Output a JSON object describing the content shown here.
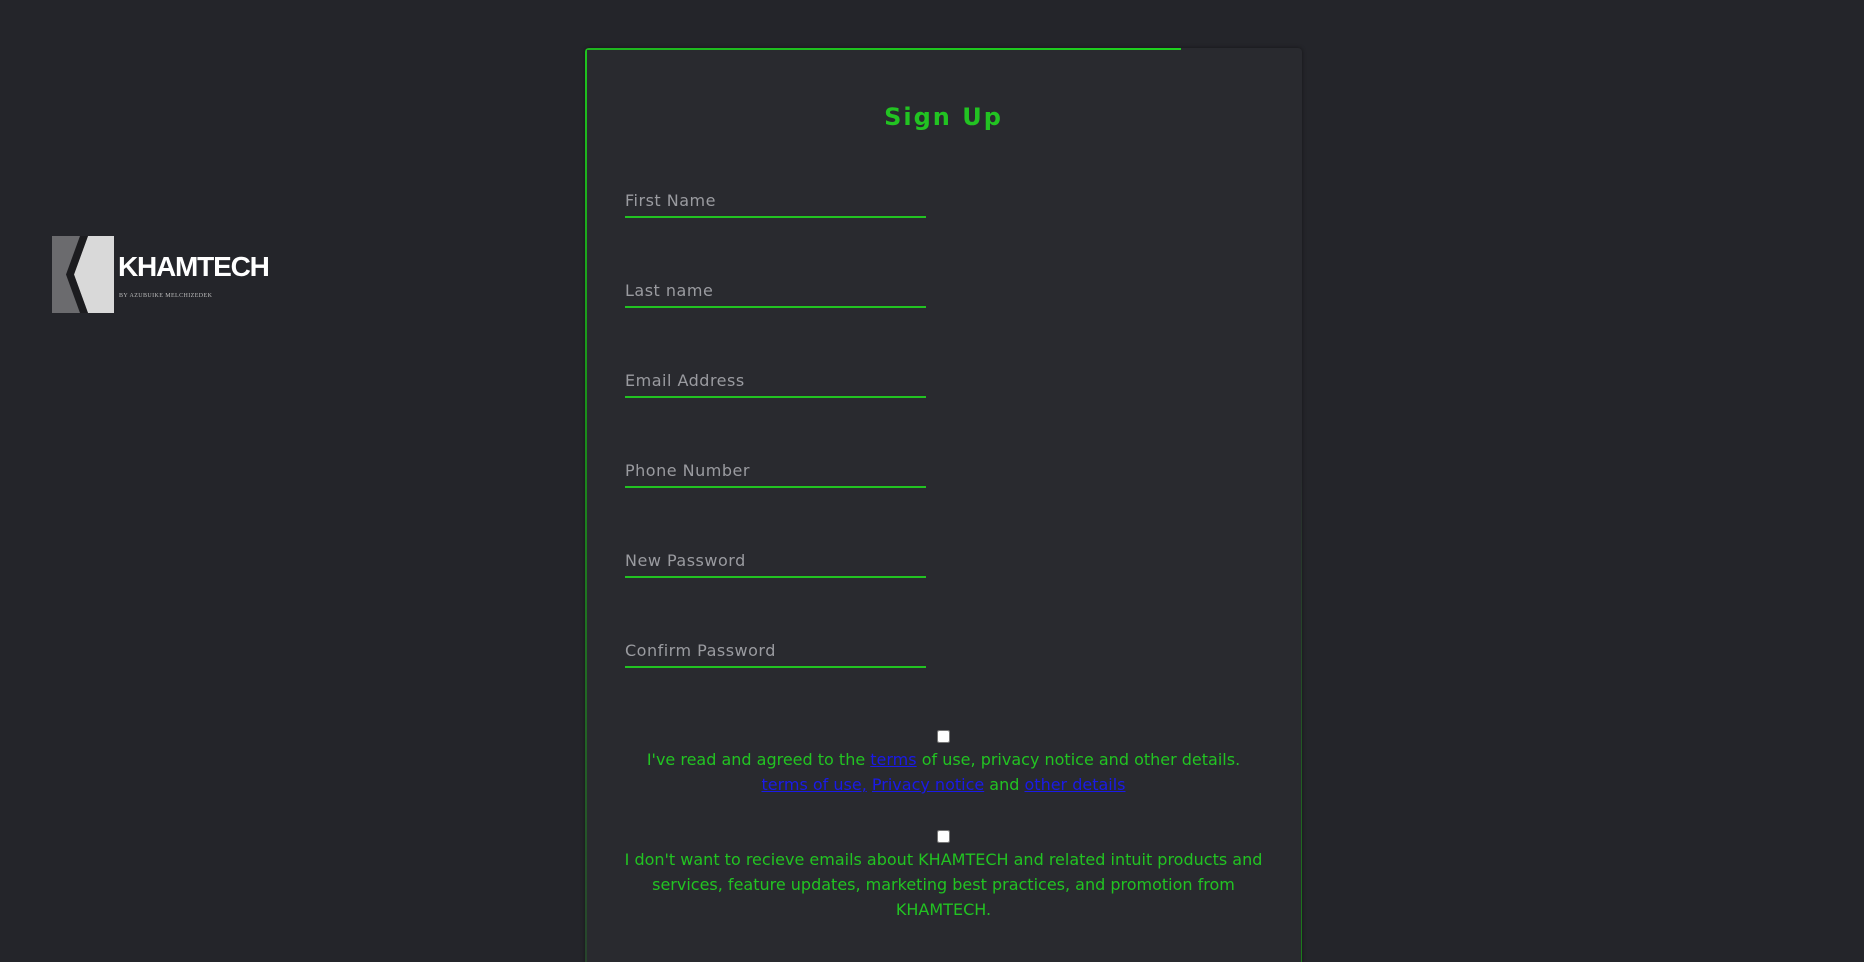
{
  "colors": {
    "page_background": "#24252a",
    "card_background": "#292a2f",
    "accent_green": "#22c322",
    "link_blue": "#1a1ae8",
    "placeholder_gray": "#9a9ba0"
  },
  "logo": {
    "wordmark": "KHAMTECH",
    "tagline": "BY AZUBUIKE MELCHIZEDEK",
    "icon": "k-chevron-logo-icon"
  },
  "form": {
    "title": "Sign Up",
    "fields": {
      "first_name": {
        "placeholder": "First Name",
        "value": ""
      },
      "last_name": {
        "placeholder": "Last name",
        "value": ""
      },
      "email": {
        "placeholder": "Email Address",
        "value": ""
      },
      "phone": {
        "placeholder": "Phone Number",
        "value": ""
      },
      "new_password": {
        "placeholder": "New Password",
        "value": ""
      },
      "confirm_password": {
        "placeholder": "Confirm Password",
        "value": ""
      }
    },
    "terms": {
      "checked": false,
      "text_before": "I've read and agreed to the ",
      "link_terms": "terms",
      "text_after": " of use, privacy notice and other details.",
      "link_terms_of_use": "terms of use,",
      "link_privacy_notice": "Privacy notice",
      "text_and": " and ",
      "link_other_details": "other details"
    },
    "marketing_optout": {
      "checked": false,
      "text": "I don't want to recieve emails about KHAMTECH and related intuit products and services, feature updates, marketing best practices, and promotion from KHAMTECH."
    }
  }
}
